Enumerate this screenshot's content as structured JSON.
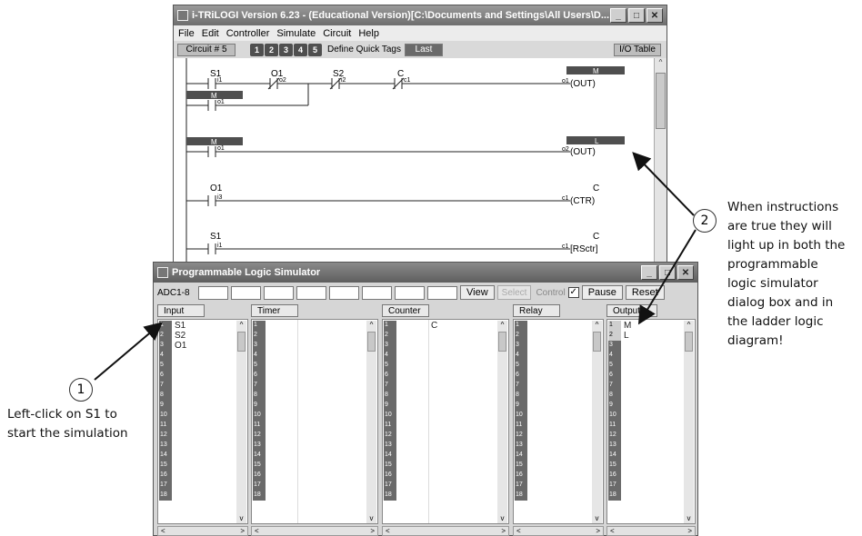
{
  "ladder_window": {
    "title": "i-TRiLOGI Version 6.23 - (Educational Version)[C:\\Documents and Settings\\All Users\\D...",
    "controls": {
      "minimize": "_",
      "maximize": "□",
      "close": "✕"
    },
    "menu": [
      "File",
      "Edit",
      "Controller",
      "Simulate",
      "Circuit",
      "Help"
    ],
    "toolbar": {
      "circuit": "Circuit # 5",
      "numbers": [
        "1",
        "2",
        "3",
        "4",
        "5"
      ],
      "define_quick_tags": "Define Quick Tags",
      "last": "Last",
      "io_table": "I/O Table"
    },
    "rungs": {
      "r1": {
        "c1": "S1",
        "c2": "O1",
        "c3": "S2",
        "c4": "C",
        "n1": "i1",
        "n2": "o2",
        "n3": "i2",
        "n4": "c1",
        "coil_tag": "M",
        "coil": "(OUT)",
        "coil_num": "o1",
        "branch": "M",
        "branch_num": "o1"
      },
      "r2": {
        "contact": "M",
        "num": "o1",
        "coil_tag": "L",
        "coil": "(OUT)",
        "coil_num": "o2"
      },
      "r3": {
        "contact": "O1",
        "num": "i3",
        "coil_tag": "C",
        "coil": "(CTR)",
        "coil_num": "c1"
      },
      "r4": {
        "contact": "S1",
        "num": "i1",
        "coil_tag": "C",
        "coil": "[RSctr]",
        "coil_num": "c1"
      }
    }
  },
  "simulator": {
    "title": "Programmable Logic Simulator",
    "controls": {
      "minimize": "_",
      "maximize": "□",
      "close": "✕"
    },
    "adc_label": "ADC1-8",
    "buttons": {
      "view": "View",
      "select": "Select",
      "control": "Control",
      "check": "✓",
      "pause": "Pause",
      "reset": "Reset"
    },
    "panels": {
      "input": {
        "title": "Input",
        "labels": [
          "S1",
          "S2",
          "O1"
        ]
      },
      "timer": {
        "title": "Timer",
        "labels": []
      },
      "counter": {
        "title": "Counter",
        "labels": [
          "C"
        ]
      },
      "relay": {
        "title": "Relay",
        "labels": []
      },
      "output": {
        "title": "Output",
        "labels": [
          "M",
          "L"
        ]
      }
    },
    "row_numbers": [
      "1",
      "2",
      "3",
      "4",
      "5",
      "6",
      "7",
      "8",
      "9",
      "10",
      "11",
      "12",
      "13",
      "14",
      "15",
      "16",
      "17",
      "18"
    ],
    "scroll": {
      "up": "^",
      "down": "v",
      "left": "<",
      "right": ">"
    }
  },
  "annotations": {
    "callout1": "1",
    "callout2": "2",
    "note1": [
      "Left-click on S1 to",
      "start the simulation"
    ],
    "note2": [
      "When instructions",
      "are true they will",
      "light up in both the",
      "programmable",
      "logic simulator",
      "dialog box and in",
      "the ladder logic",
      "diagram!"
    ]
  },
  "colors": {
    "highlight_bar": "#4f4f4f",
    "title_bar": "#707070"
  }
}
